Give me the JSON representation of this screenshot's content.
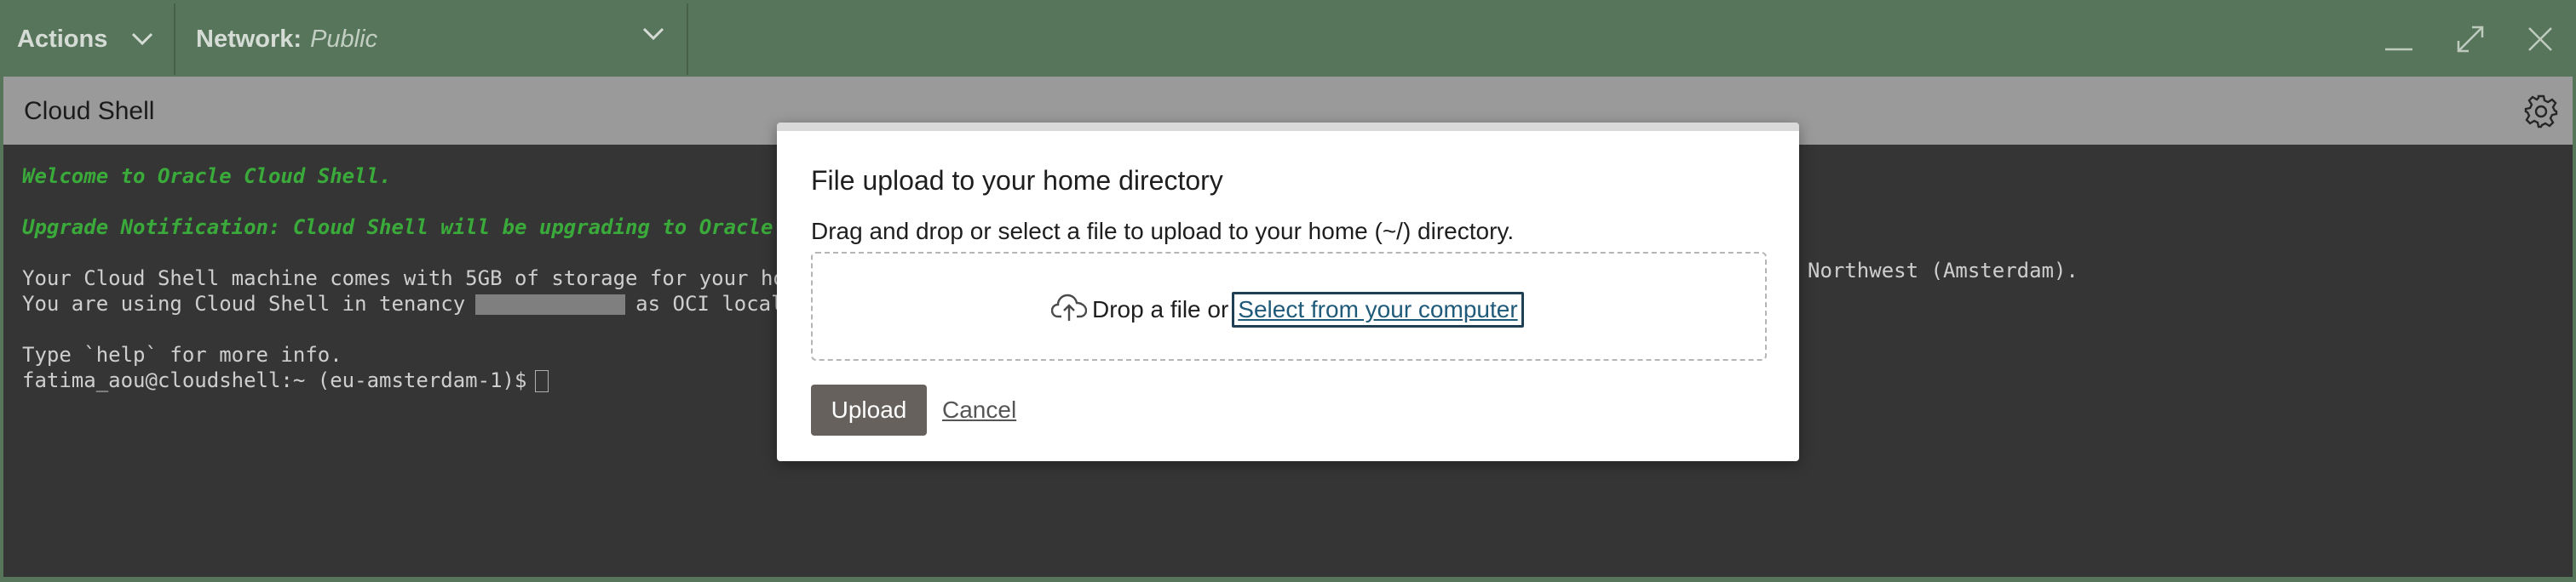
{
  "topbar": {
    "actions_label": "Actions",
    "network_label": "Network:",
    "network_value": "Public",
    "window_controls": [
      "minimize-icon",
      "maximize-icon",
      "close-icon"
    ]
  },
  "titlebar": {
    "title": "Cloud Shell",
    "settings_icon": "gear-icon"
  },
  "terminal": {
    "line1": "Welcome to Oracle Cloud Shell.",
    "line2": "Upgrade Notification: Cloud Shell will be upgrading to Oracle L",
    "line3": "Your Cloud Shell machine comes with 5GB of storage for your home",
    "line3_tail": "Northwest (Amsterdam).",
    "line4_prefix": "You are using Cloud Shell in tenancy",
    "line4_suffix": "as OCI local",
    "line5": "Type `help` for more info.",
    "prompt": "fatima_aou@cloudshell:~ (eu-amsterdam-1)$"
  },
  "dialog": {
    "title": "File upload to your home directory",
    "description": "Drag and drop or select a file to upload to your home (~/) directory.",
    "drop_text": "Drop a file or",
    "select_link": "Select from your computer",
    "upload_button": "Upload",
    "cancel_link": "Cancel",
    "upload_icon": "cloud-upload-icon"
  },
  "colors": {
    "frame_green": "#5f7f62",
    "terminal_bg": "#3a3a3a",
    "terminal_green": "#3fb93f",
    "upload_btn": "#66615c",
    "link": "#1f5a7a"
  }
}
